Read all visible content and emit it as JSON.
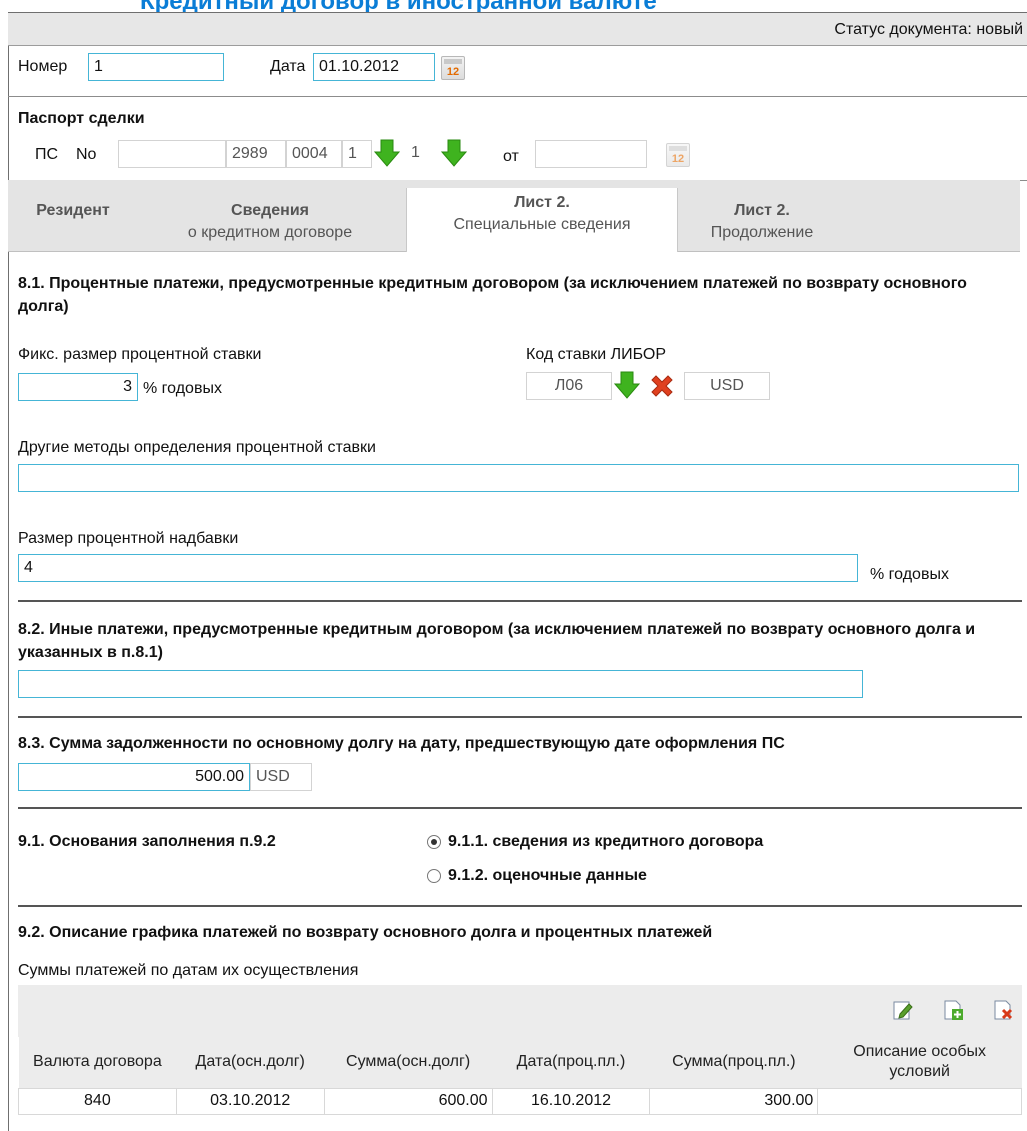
{
  "header": {
    "page_title": "Кредитный договор в иностранной валюте",
    "status_label": "Статус документа:",
    "status_value": "новый"
  },
  "doc": {
    "number_label": "Номер",
    "number_value": "1",
    "date_label": "Дата",
    "date_value": "01.10.2012",
    "cal_icon_text": "12"
  },
  "passport": {
    "title": "Паспорт сделки",
    "ps_label": "ПС",
    "no_label": "No",
    "part1": "",
    "part2": "2989",
    "part3": "0004",
    "part4": "1",
    "part5": "1",
    "from_label": "от",
    "from_value": ""
  },
  "tabs": [
    {
      "line1": "Резидент",
      "line2": ""
    },
    {
      "line1": "Сведения",
      "line2": "о кредитном договоре"
    },
    {
      "line1": "Лист 2.",
      "line2": "Специальные сведения"
    },
    {
      "line1": "Лист 2.",
      "line2": "Продолжение"
    }
  ],
  "s81": {
    "title": "8.1. Процентные платежи, предусмотренные кредитным договором (за исключением платежей по возврату основного долга)",
    "fixed_rate_label": "Фикс. размер процентной ставки",
    "fixed_rate_value": "3",
    "percent_label": "% годовых",
    "libor_label": "Код ставки ЛИБОР",
    "libor_code": "Л06",
    "libor_currency": "USD",
    "other_methods_label": "Другие методы определения процентной ставки",
    "other_methods_value": "",
    "markup_label": "Размер процентной надбавки",
    "markup_value": "4",
    "markup_unit": "% годовых"
  },
  "s82": {
    "title": "8.2. Иные платежи, предусмотренные кредитным договором (за исключением платежей по возврату основного долга и указанных в п.8.1)",
    "value": ""
  },
  "s83": {
    "title": "8.3. Сумма задолженности по основному долгу на дату, предшествующую дате оформления ПС",
    "amount": "500.00",
    "currency": "USD"
  },
  "s91": {
    "title": "9.1. Основания заполнения п.9.2",
    "option1": "9.1.1. сведения из кредитного договора",
    "option2": "9.1.2. оценочные данные",
    "selected": 1
  },
  "s92": {
    "title": "9.2. Описание графика платежей по возврату основного долга и процентных платежей",
    "subtitle": "Суммы платежей по датам их осуществления",
    "columns": [
      "Валюта договора",
      "Дата(осн.долг)",
      "Сумма(осн.долг)",
      "Дата(проц.пл.)",
      "Сумма(проц.пл.)",
      "Описание особых условий"
    ],
    "rows": [
      [
        "840",
        "03.10.2012",
        "600.00",
        "16.10.2012",
        "300.00",
        ""
      ]
    ]
  },
  "colors": {
    "accent": "#0a7dd6",
    "input_border": "#45b5d6",
    "green_arrow": "#3fb31f",
    "red_x": "#e0401f"
  }
}
